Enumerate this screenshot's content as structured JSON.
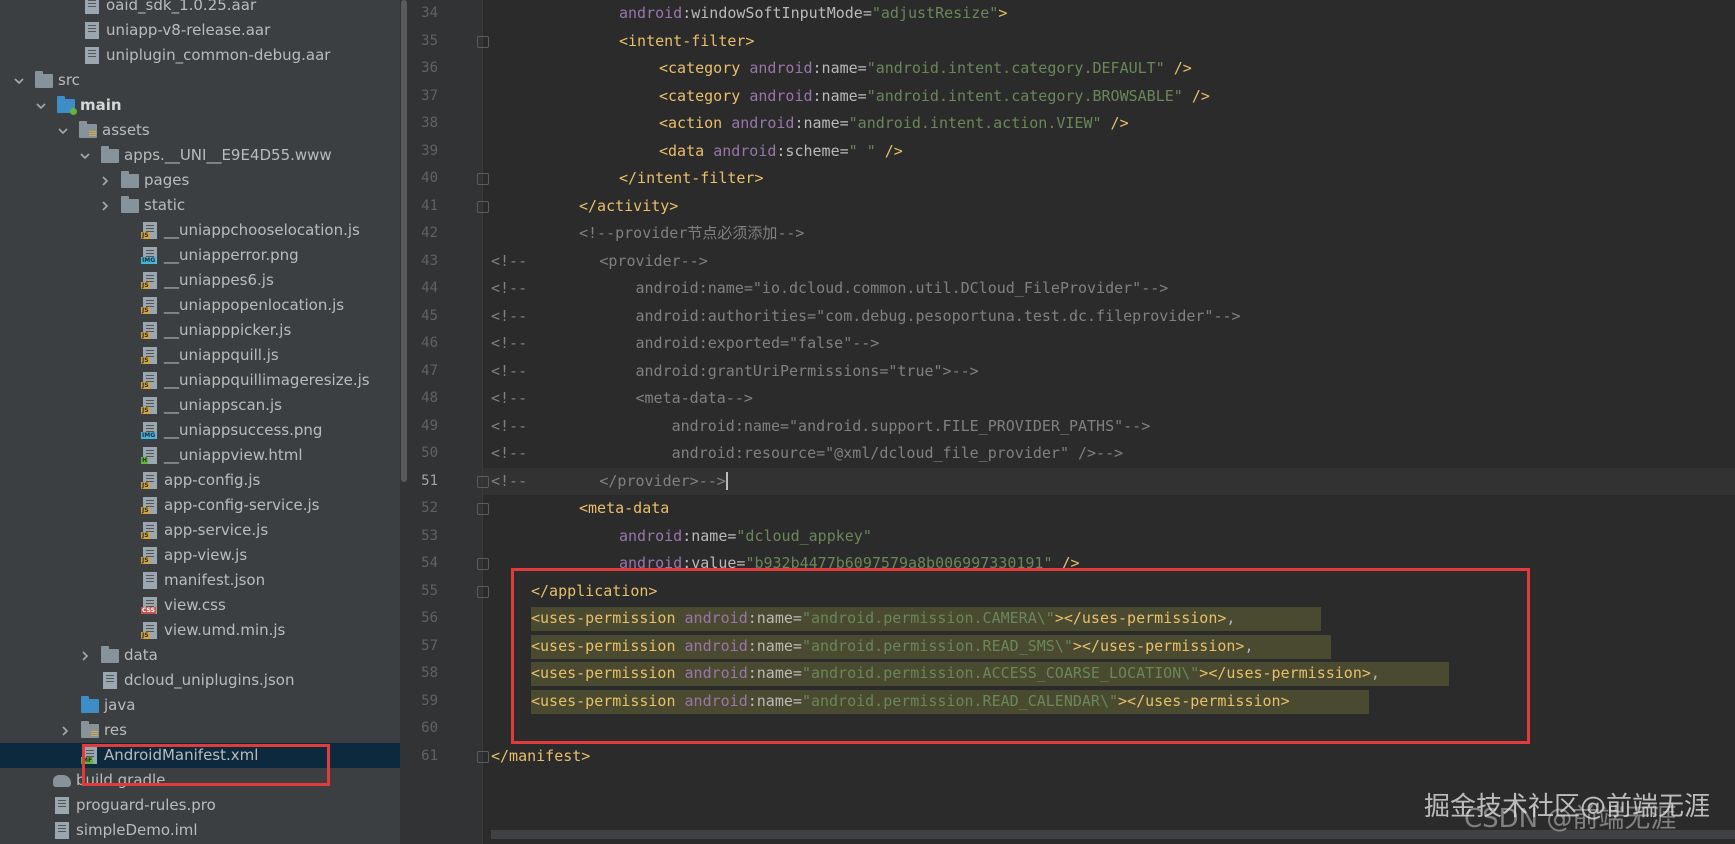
{
  "project_tree": {
    "items": [
      {
        "label": "oaid_sdk_1.0.25.aar",
        "icon": "file-icon"
      },
      {
        "label": "uniapp-v8-release.aar",
        "icon": "file-icon"
      },
      {
        "label": "uniplugin_common-debug.aar",
        "icon": "file-icon"
      },
      {
        "label": "src",
        "icon": "folder-icon"
      },
      {
        "label": "main",
        "icon": "folder-icon"
      },
      {
        "label": "assets",
        "icon": "folder-icon"
      },
      {
        "label": "apps.__UNI__E9E4D55.www",
        "icon": "folder-icon"
      },
      {
        "label": "pages",
        "icon": "folder-icon"
      },
      {
        "label": "static",
        "icon": "folder-icon"
      },
      {
        "label": "__uniappchooselocation.js",
        "icon": "js-file-icon"
      },
      {
        "label": "__uniapperror.png",
        "icon": "image-file-icon"
      },
      {
        "label": "__uniappes6.js",
        "icon": "js-file-icon"
      },
      {
        "label": "__uniappopenlocation.js",
        "icon": "js-file-icon"
      },
      {
        "label": "__uniapppicker.js",
        "icon": "js-file-icon"
      },
      {
        "label": "__uniappquill.js",
        "icon": "js-file-icon"
      },
      {
        "label": "__uniappquillimageresize.js",
        "icon": "js-file-icon"
      },
      {
        "label": "__uniappscan.js",
        "icon": "js-file-icon"
      },
      {
        "label": "__uniappsuccess.png",
        "icon": "image-file-icon"
      },
      {
        "label": "__uniappview.html",
        "icon": "html-file-icon"
      },
      {
        "label": "app-config.js",
        "icon": "js-file-icon"
      },
      {
        "label": "app-config-service.js",
        "icon": "js-file-icon"
      },
      {
        "label": "app-service.js",
        "icon": "js-file-icon"
      },
      {
        "label": "app-view.js",
        "icon": "js-file-icon"
      },
      {
        "label": "manifest.json",
        "icon": "json-file-icon"
      },
      {
        "label": "view.css",
        "icon": "css-file-icon"
      },
      {
        "label": "view.umd.min.js",
        "icon": "js-file-icon"
      },
      {
        "label": "data",
        "icon": "folder-icon"
      },
      {
        "label": "dcloud_uniplugins.json",
        "icon": "json-file-icon"
      },
      {
        "label": "java",
        "icon": "folder-icon"
      },
      {
        "label": "res",
        "icon": "folder-icon"
      },
      {
        "label": "AndroidManifest.xml",
        "icon": "manifest-file-icon"
      },
      {
        "label": "build.gradle",
        "icon": "gradle-icon"
      },
      {
        "label": "proguard-rules.pro",
        "icon": "file-icon"
      },
      {
        "label": "simpleDemo.iml",
        "icon": "file-icon"
      }
    ]
  },
  "editor": {
    "line_numbers": [
      "34",
      "35",
      "36",
      "37",
      "38",
      "39",
      "40",
      "41",
      "42",
      "43",
      "44",
      "45",
      "46",
      "47",
      "48",
      "49",
      "50",
      "51",
      "52",
      "53",
      "54",
      "55",
      "56",
      "57",
      "58",
      "59",
      "60",
      "61"
    ],
    "current_line": "51",
    "lines": [
      [
        {
          "t": "android",
          "c": "ns"
        },
        {
          "t": ":windowSoftInputMode=",
          "c": "attr"
        },
        {
          "t": "\"adjustResize\"",
          "c": "val"
        },
        {
          "t": ">",
          "c": "tag"
        }
      ],
      [
        {
          "t": "<intent-filter>",
          "c": "tag"
        }
      ],
      [
        {
          "t": "<category ",
          "c": "tag"
        },
        {
          "t": "android",
          "c": "ns"
        },
        {
          "t": ":name=",
          "c": "attr"
        },
        {
          "t": "\"android.intent.category.DEFAULT\"",
          "c": "val"
        },
        {
          "t": " />",
          "c": "tag"
        }
      ],
      [
        {
          "t": "<category ",
          "c": "tag"
        },
        {
          "t": "android",
          "c": "ns"
        },
        {
          "t": ":name=",
          "c": "attr"
        },
        {
          "t": "\"android.intent.category.BROWSABLE\"",
          "c": "val"
        },
        {
          "t": " />",
          "c": "tag"
        }
      ],
      [
        {
          "t": "<action ",
          "c": "tag"
        },
        {
          "t": "android",
          "c": "ns"
        },
        {
          "t": ":name=",
          "c": "attr"
        },
        {
          "t": "\"android.intent.action.VIEW\"",
          "c": "val"
        },
        {
          "t": " />",
          "c": "tag"
        }
      ],
      [
        {
          "t": "<data ",
          "c": "tag"
        },
        {
          "t": "android",
          "c": "ns"
        },
        {
          "t": ":scheme=",
          "c": "attr"
        },
        {
          "t": "\" \"",
          "c": "val"
        },
        {
          "t": " />",
          "c": "tag"
        }
      ],
      [
        {
          "t": "</intent-filter>",
          "c": "tag"
        }
      ],
      [
        {
          "t": "</activity>",
          "c": "tag"
        }
      ],
      [
        {
          "t": "<!--provider节点必须添加-->",
          "c": "cmt"
        }
      ],
      [
        {
          "t": "<!--        <provider-->",
          "c": "cmt"
        }
      ],
      [
        {
          "t": "<!--            android:name=\"io.dcloud.common.util.DCloud_FileProvider\"-->",
          "c": "cmt"
        }
      ],
      [
        {
          "t": "<!--            android:authorities=\"com.debug.pesoportuna.test.dc.fileprovider\"-->",
          "c": "cmt"
        }
      ],
      [
        {
          "t": "<!--            android:exported=\"false\"-->",
          "c": "cmt"
        }
      ],
      [
        {
          "t": "<!--            android:grantUriPermissions=\"true\">-->",
          "c": "cmt"
        }
      ],
      [
        {
          "t": "<!--            <meta-data-->",
          "c": "cmt"
        }
      ],
      [
        {
          "t": "<!--                android:name=\"android.support.FILE_PROVIDER_PATHS\"-->",
          "c": "cmt"
        }
      ],
      [
        {
          "t": "<!--                android:resource=\"@xml/dcloud_file_provider\" />-->",
          "c": "cmt"
        }
      ],
      [
        {
          "t": "<!--        </provider>-->",
          "c": "cmt"
        }
      ],
      [
        {
          "t": "<meta-data",
          "c": "tag"
        }
      ],
      [
        {
          "t": "android",
          "c": "ns"
        },
        {
          "t": ":name=",
          "c": "attr"
        },
        {
          "t": "\"dcloud_appkey\"",
          "c": "val"
        }
      ],
      [
        {
          "t": "android",
          "c": "ns"
        },
        {
          "t": ":value=",
          "c": "attr"
        },
        {
          "t": "\"b932b4477b6097579a8b006997330191\"",
          "c": "val"
        },
        {
          "t": " />",
          "c": "tag"
        }
      ],
      [
        {
          "t": "</application>",
          "c": "tag"
        }
      ],
      [
        {
          "t": "<uses-permission ",
          "c": "tag"
        },
        {
          "t": "android",
          "c": "ns"
        },
        {
          "t": ":name=",
          "c": "attr"
        },
        {
          "t": "\"android.permission.CAMERA\\\"",
          "c": "val"
        },
        {
          "t": "></uses-permission>",
          "c": "tag"
        },
        {
          "t": ",",
          "c": "plain"
        }
      ],
      [
        {
          "t": "<uses-permission ",
          "c": "tag"
        },
        {
          "t": "android",
          "c": "ns"
        },
        {
          "t": ":name=",
          "c": "attr"
        },
        {
          "t": "\"android.permission.READ_SMS\\\"",
          "c": "val"
        },
        {
          "t": "></uses-permission>",
          "c": "tag"
        },
        {
          "t": ",",
          "c": "plain"
        }
      ],
      [
        {
          "t": "<uses-permission ",
          "c": "tag"
        },
        {
          "t": "android",
          "c": "ns"
        },
        {
          "t": ":name=",
          "c": "attr"
        },
        {
          "t": "\"android.permission.ACCESS_COARSE_LOCATION\\\"",
          "c": "val"
        },
        {
          "t": "></uses-permission>",
          "c": "tag"
        },
        {
          "t": ",",
          "c": "plain"
        }
      ],
      [
        {
          "t": "<uses-permission ",
          "c": "tag"
        },
        {
          "t": "android",
          "c": "ns"
        },
        {
          "t": ":name=",
          "c": "attr"
        },
        {
          "t": "\"android.permission.READ_CALENDAR\\\"",
          "c": "val"
        },
        {
          "t": "></uses-permission>",
          "c": "tag"
        }
      ],
      [],
      [
        {
          "t": "</manifest>",
          "c": "tag"
        }
      ]
    ]
  },
  "watermark": {
    "text": "掘金技术社区@前端无涯",
    "under_text": "CSDN @前端无涯"
  },
  "colors": {
    "highlight_box": "#e23b3b",
    "selection_row": "#0d293e",
    "tag": "#e8bf6a",
    "namespace": "#9876aa",
    "value": "#6a8759",
    "comment": "#808080"
  }
}
